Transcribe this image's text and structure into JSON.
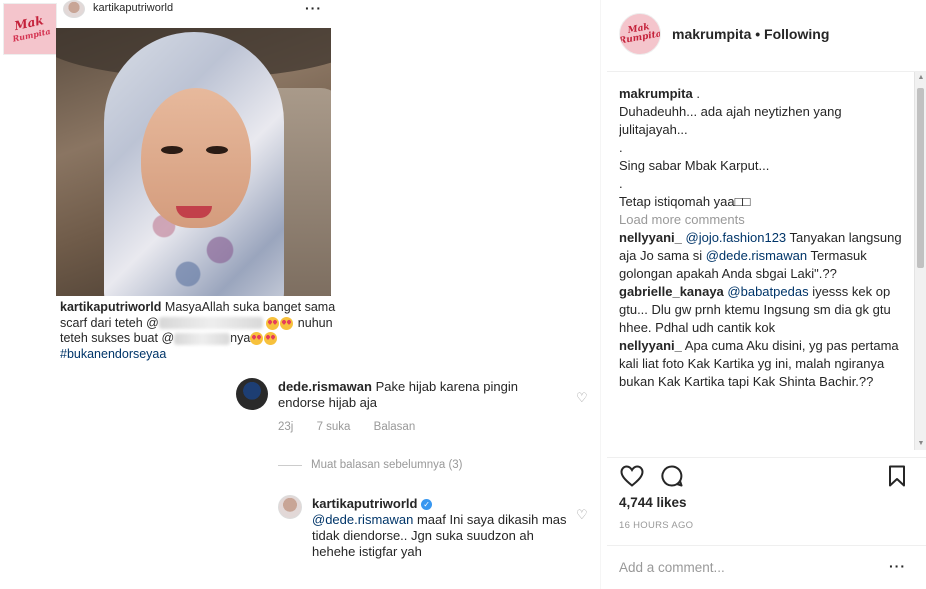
{
  "left": {
    "brand_logo": {
      "line1": "Mak",
      "line2": "Rumpita"
    },
    "post_username": "kartikaputriworld",
    "post_more": "···",
    "caption": {
      "username": "kartikaputriworld",
      "text_1": "MasyaAllah suka banget sama scarf dari teteh @",
      "text_2": " nuhun teteh sukses buat @",
      "text_3": "nya",
      "hashtag": "#bukanendorseyaa"
    },
    "reply_1": {
      "username": "dede.rismawan",
      "text": "Pake hijab karena pingin endorse  hijab aja",
      "time": "23j",
      "likes": "7 suka",
      "reply": "Balasan"
    },
    "load_replies": "Muat balasan sebelumnya (3)",
    "reply_2": {
      "username": "kartikaputriworld",
      "mention": "@dede.rismawan",
      "text": " maaf Ini saya dikasih mas tidak diendorse.. Jgn suka suudzon ah hehehe istigfar yah"
    }
  },
  "right": {
    "header": {
      "username": "makrumpita",
      "separator": "•",
      "following": "Following",
      "logo_line1": "Mak",
      "logo_line2": "Rumpita"
    },
    "post_caption": {
      "username": "makrumpita",
      "suffix": " .",
      "lines": [
        "Duhadeuhh... ada ajah neytizhen yang julitajayah...",
        ".",
        "Sing sabar Mbak Karput...",
        ".",
        "Tetap istiqomah yaa□□"
      ]
    },
    "load_more": "Load more comments",
    "comments": [
      {
        "username": "nellyyani_",
        "mention": "@jojo.fashion123",
        "text_a": " Tanyakan langsung aja Jo sama si ",
        "mention_b": "@dede.rismawan",
        "text_b": " Termasuk golongan apakah Anda sbgai Laki\".??"
      },
      {
        "username": "gabrielle_kanaya",
        "mention": "@babatpedas",
        "text_a": " iyesss kek op gtu... Dlu gw prnh ktemu Ingsung sm dia gk gtu hhee. Pdhal udh cantik kok",
        "mention_b": "",
        "text_b": ""
      },
      {
        "username": "nellyyani_",
        "mention": "",
        "text_a": " Apa cuma Aku disini, yg pas pertama kali liat foto Kak Kartika yg ini, malah ngiranya bukan Kak Kartika tapi Kak Shinta Bachir.??",
        "mention_b": "",
        "text_b": ""
      }
    ],
    "likes": "4,744 likes",
    "time": "16 HOURS AGO",
    "add_comment_placeholder": "Add a comment...",
    "more": "···",
    "icons": {
      "like": "heart-icon",
      "comment": "comment-icon",
      "save": "bookmark-icon"
    }
  }
}
